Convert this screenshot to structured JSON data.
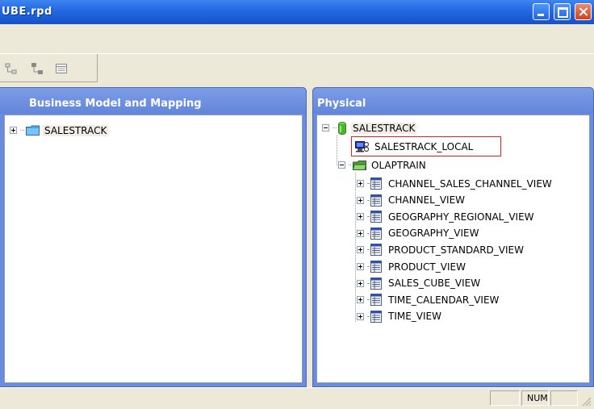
{
  "window": {
    "title": "UBE.rpd",
    "buttons": [
      "minimize-button",
      "maximize-button",
      "close-button"
    ]
  },
  "toolbar": {
    "icons": [
      "hierarchy-icon",
      "hierarchy-alt-icon",
      "table-view-icon"
    ]
  },
  "business_panel": {
    "title": "Business Model and Mapping",
    "items": [
      {
        "label": "SALESTRACK",
        "icon": "folder-icon",
        "expanded": false
      }
    ]
  },
  "physical_panel": {
    "title": "Physical",
    "database": {
      "label": "SALESTRACK",
      "icon": "database-icon",
      "expanded": true
    },
    "connection_pool": {
      "label": "SALESTRACK_LOCAL",
      "icon": "connection-pool-icon",
      "highlighted": true
    },
    "schema": {
      "label": "OLAPTRAIN",
      "icon": "schema-folder-icon",
      "expanded": true
    },
    "tables": [
      "CHANNEL_SALES_CHANNEL_VIEW",
      "CHANNEL_VIEW",
      "GEOGRAPHY_REGIONAL_VIEW",
      "GEOGRAPHY_VIEW",
      "PRODUCT_STANDARD_VIEW",
      "PRODUCT_VIEW",
      "SALES_CUBE_VIEW",
      "TIME_CALENDAR_VIEW",
      "TIME_VIEW"
    ]
  },
  "statusbar": {
    "num_indicator": "NUM"
  },
  "colors": {
    "title_bar": "#1a5ed8",
    "panel_header": "#6b8bdc",
    "highlight_box": "#e02020"
  }
}
